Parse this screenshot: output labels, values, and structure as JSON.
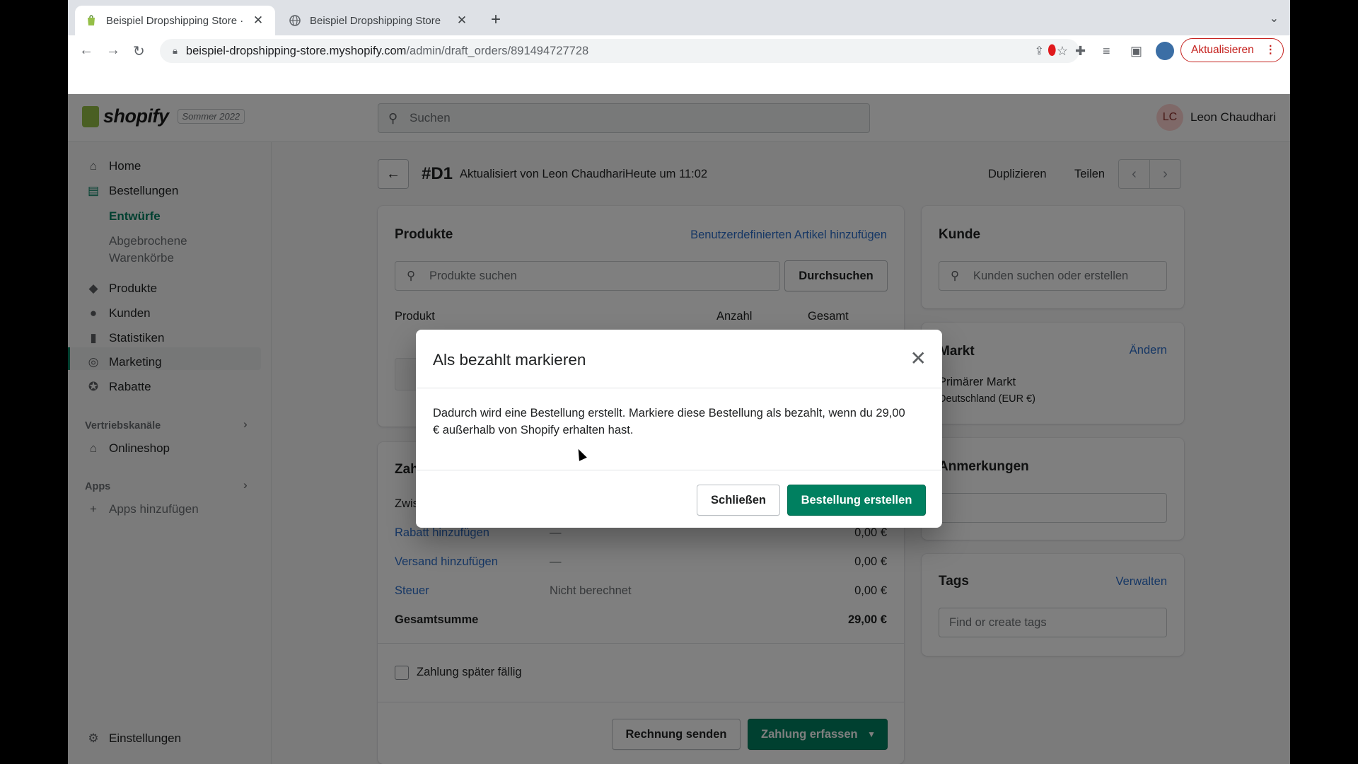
{
  "browser": {
    "tabs": [
      {
        "title": "Beispiel Dropshipping Store · E",
        "close": "✕"
      },
      {
        "title": "Beispiel Dropshipping Store",
        "close": "✕"
      }
    ],
    "new_tab": "+",
    "url_host": "beispiel-dropshipping-store.myshopify.com",
    "url_path": "/admin/draft_orders/891494727728",
    "update_label": "Aktualisieren"
  },
  "topbar": {
    "logo_text": "shopify",
    "edition": "Sommer 2022",
    "search_placeholder": "Suchen",
    "user_initials": "LC",
    "user_name": "Leon Chaudhari"
  },
  "sidebar": {
    "items": [
      {
        "label": "Home",
        "icon": "home-icon"
      },
      {
        "label": "Bestellungen",
        "icon": "orders-icon"
      },
      {
        "label": "Entwürfe"
      },
      {
        "label": "Abgebrochene Warenkörbe"
      },
      {
        "label": "Produkte",
        "icon": "tag-icon"
      },
      {
        "label": "Kunden",
        "icon": "person-icon"
      },
      {
        "label": "Statistiken",
        "icon": "chart-icon"
      },
      {
        "label": "Marketing",
        "icon": "target-icon"
      },
      {
        "label": "Rabatte",
        "icon": "discount-icon"
      }
    ],
    "sales_channels": "Vertriebskanäle",
    "online_store": "Onlineshop",
    "apps": "Apps",
    "add_apps": "Apps hinzufügen",
    "settings": "Einstellungen"
  },
  "page": {
    "order_id": "#D1",
    "updated": "Aktualisiert von Leon ChaudhariHeute um 11:02",
    "duplicate": "Duplizieren",
    "share": "Teilen"
  },
  "products_card": {
    "title": "Produkte",
    "custom_item_link": "Benutzerdefinierten Artikel hinzufügen",
    "search_placeholder": "Produkte suchen",
    "browse": "Durchsuchen",
    "col_product": "Produkt",
    "col_qty": "Anzahl",
    "col_total": "Gesamt"
  },
  "payment_card": {
    "title": "Zahlung",
    "subtotal": "Zwischensumme",
    "discount_link": "Rabatt hinzufügen",
    "discount_value": "—",
    "discount_amount": "0,00 €",
    "shipping_link": "Versand hinzufügen",
    "shipping_value": "—",
    "shipping_amount": "0,00 €",
    "tax_link": "Steuer",
    "tax_value": "Nicht berechnet",
    "tax_amount": "0,00 €",
    "total_label": "Gesamtsumme",
    "total_amount": "29,00 €",
    "pay_later": "Zahlung später fällig",
    "send_invoice": "Rechnung senden",
    "collect_payment": "Zahlung erfassen"
  },
  "customer_card": {
    "title": "Kunde",
    "search_placeholder": "Kunden suchen oder erstellen"
  },
  "market_card": {
    "title": "Markt",
    "change": "Ändern",
    "primary": "Primärer Markt",
    "country": "Deutschland (EUR €)"
  },
  "notes_card": {
    "title": "Anmerkungen"
  },
  "tags_card": {
    "title": "Tags",
    "manage": "Verwalten",
    "placeholder": "Find or create tags"
  },
  "modal": {
    "title": "Als bezahlt markieren",
    "body": "Dadurch wird eine Bestellung erstellt. Markiere diese Bestellung als bezahlt, wenn du 29,00 € außerhalb von Shopify erhalten hast.",
    "close_btn": "Schließen",
    "create_btn": "Bestellung erstellen"
  }
}
